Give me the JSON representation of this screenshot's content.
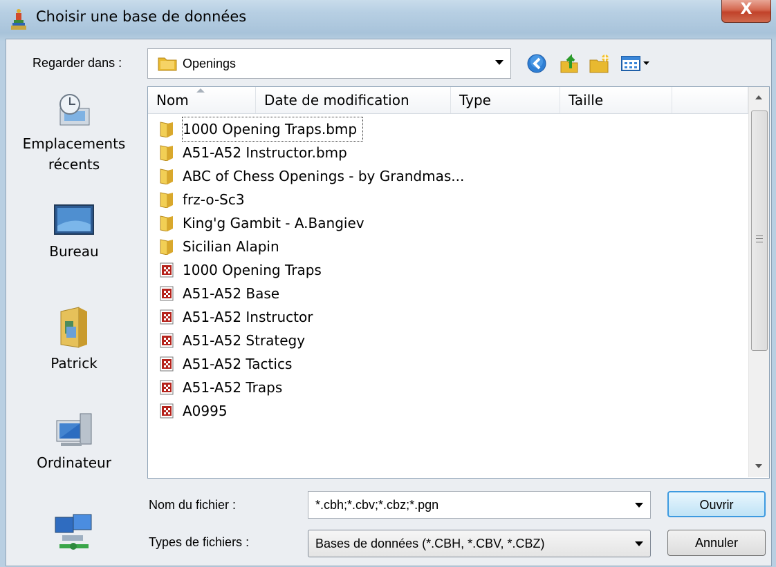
{
  "window": {
    "title": "Choisir une base de données",
    "close_label": "X"
  },
  "lookin": {
    "label": "Regarder dans :",
    "value": "Openings"
  },
  "toolbar": {
    "back_icon": "back-icon",
    "up_icon": "up-folder-icon",
    "new_folder_icon": "new-folder-icon",
    "views_icon": "views-menu-icon"
  },
  "places": [
    {
      "label": "Emplacements récents",
      "icon": "recent-places-icon"
    },
    {
      "label": "Bureau",
      "icon": "desktop-icon"
    },
    {
      "label": "Patrick",
      "icon": "user-folder-icon"
    },
    {
      "label": "Ordinateur",
      "icon": "computer-icon"
    },
    {
      "label": "",
      "icon": "network-icon"
    }
  ],
  "columns": [
    "Nom",
    "Date de modification",
    "Type",
    "Taille"
  ],
  "files": [
    {
      "name": "1000 Opening Traps.bmp",
      "kind": "folder"
    },
    {
      "name": "A51-A52 Instructor.bmp",
      "kind": "folder"
    },
    {
      "name": "ABC of Chess Openings  - by Grandmas...",
      "kind": "folder"
    },
    {
      "name": "frz-o-Sc3",
      "kind": "folder"
    },
    {
      "name": "King'g Gambit - A.Bangiev",
      "kind": "folder"
    },
    {
      "name": "Sicilian Alapin",
      "kind": "folder"
    },
    {
      "name": "1000 Opening Traps",
      "kind": "database"
    },
    {
      "name": "A51-A52 Base",
      "kind": "database"
    },
    {
      "name": "A51-A52 Instructor",
      "kind": "database"
    },
    {
      "name": "A51-A52 Strategy",
      "kind": "database"
    },
    {
      "name": "A51-A52 Tactics",
      "kind": "database"
    },
    {
      "name": "A51-A52 Traps",
      "kind": "database"
    },
    {
      "name": "A0995",
      "kind": "database"
    }
  ],
  "filename": {
    "label": "Nom du fichier :",
    "value": "*.cbh;*.cbv;*.cbz;*.pgn"
  },
  "filetype": {
    "label": "Types de fichiers :",
    "value": "Bases de données (*.CBH, *.CBV, *.CBZ)"
  },
  "buttons": {
    "open": "Ouvrir",
    "cancel": "Annuler"
  },
  "colors": {
    "selected_outline": "#333333",
    "open_button_border": "#3d9ae0"
  }
}
